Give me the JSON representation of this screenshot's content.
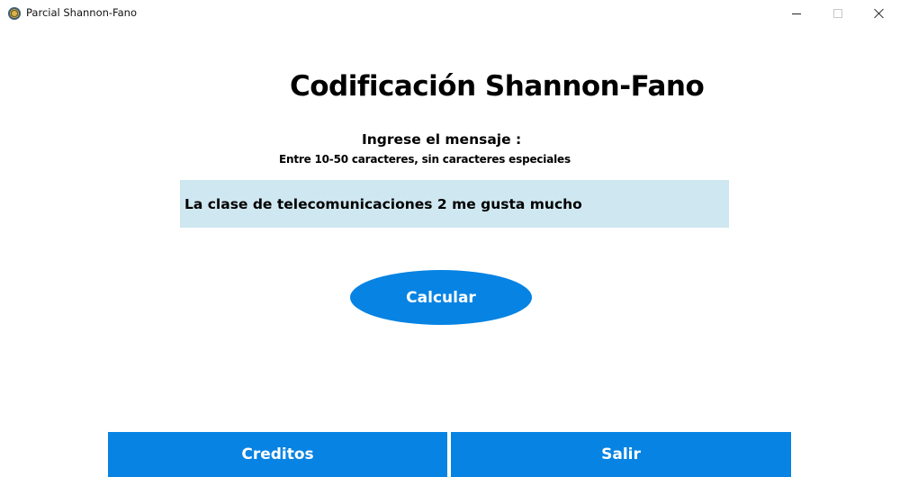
{
  "window": {
    "title": "Parcial Shannon-Fano",
    "icon": "app-emblem-icon"
  },
  "main": {
    "title": "Codificación Shannon-Fano",
    "prompt": "Ingrese el mensaje :",
    "hint": "Entre 10-50 caracteres, sin caracteres especiales",
    "message_value": "La clase de telecomunicaciones 2 me gusta mucho",
    "calculate_label": "Calcular"
  },
  "footer": {
    "credits_label": "Creditos",
    "exit_label": "Salir"
  },
  "colors": {
    "accent": "#0783e3",
    "input_background": "#cfe7f0"
  }
}
